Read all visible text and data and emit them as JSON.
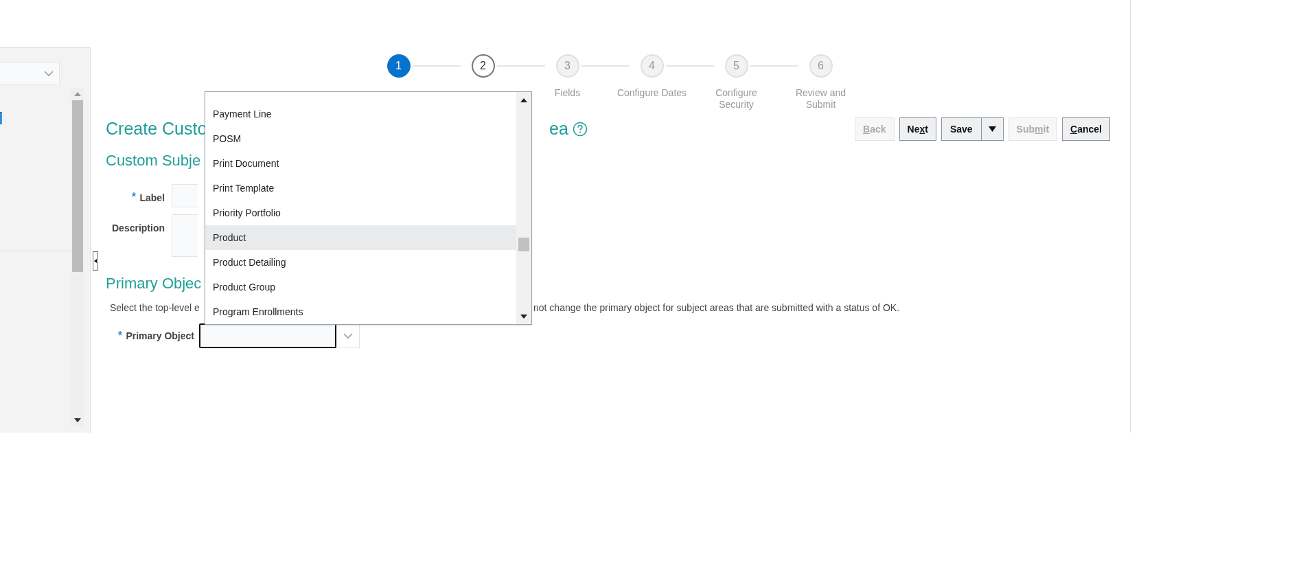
{
  "steps": [
    {
      "number": "1",
      "selected": true
    },
    {
      "number": "2",
      "selected": false,
      "visited": true
    },
    {
      "number": "3",
      "selected": false,
      "visited": false,
      "label": "Fields"
    },
    {
      "number": "4",
      "selected": false,
      "visited": false,
      "label": "Configure Dates"
    },
    {
      "number": "5",
      "selected": false,
      "visited": false,
      "label": "Configure Security"
    },
    {
      "number": "6",
      "selected": false,
      "visited": false,
      "label": "Review and Submit"
    }
  ],
  "buttons": [
    {
      "access_key": "B",
      "label_end": "ack",
      "disabled": true,
      "kind": "plain"
    },
    {
      "label_start": "Ne",
      "access_key": "x",
      "label_end": "t",
      "disabled": false,
      "kind": "plain"
    },
    {
      "label_start": "Save",
      "disabled": false,
      "kind": "split"
    },
    {
      "label_start": "Sub",
      "access_key": "m",
      "label_end": "it",
      "disabled": true,
      "kind": "plain"
    },
    {
      "access_key": "C",
      "label_end": "ancel",
      "disabled": false,
      "kind": "plain"
    }
  ],
  "page_title_left": "Create Custo",
  "page_title_right": "ea",
  "section_1": "Custom Subje",
  "fields": [
    {
      "label": "Label",
      "required_mark": "*",
      "kind": "text"
    },
    {
      "label": "Description",
      "kind": "textarea"
    }
  ],
  "section_2": "Primary Objec",
  "instruction_left": "Select the top-level e",
  "instruction_right": "not change the primary object for subject areas that are submitted with a status of OK.",
  "primary_object": {
    "label": "Primary Object",
    "required_mark": "*"
  },
  "dropdown_items": [
    {
      "label": "Payment Line",
      "selected": false
    },
    {
      "label": "POSM",
      "selected": false
    },
    {
      "label": "Print Document",
      "selected": false
    },
    {
      "label": "Print Template",
      "selected": false
    },
    {
      "label": "Priority Portfolio",
      "selected": false
    },
    {
      "label": "Product",
      "selected": true
    },
    {
      "label": "Product Detailing",
      "selected": false
    },
    {
      "label": "Product Group",
      "selected": false
    },
    {
      "label": "Program Enrollments",
      "selected": false
    }
  ]
}
